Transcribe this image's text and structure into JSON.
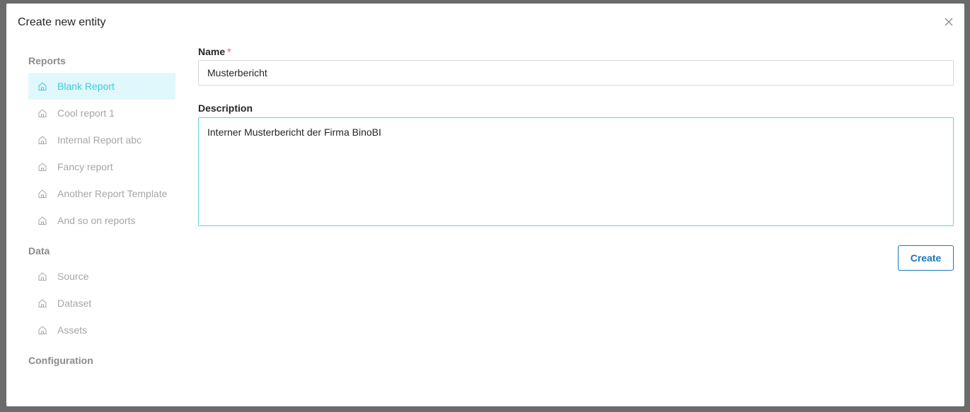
{
  "modal": {
    "title": "Create new entity",
    "close_icon": "close-icon"
  },
  "sidebar": {
    "sections": [
      {
        "title": "Reports",
        "items": [
          {
            "label": "Blank Report",
            "icon": "home-icon",
            "active": true
          },
          {
            "label": "Cool report 1",
            "icon": "home-icon"
          },
          {
            "label": "Internal Report abc",
            "icon": "home-icon"
          },
          {
            "label": "Fancy report",
            "icon": "home-icon"
          },
          {
            "label": "Another Report Template",
            "icon": "home-icon"
          },
          {
            "label": "And so on reports",
            "icon": "home-icon"
          }
        ]
      },
      {
        "title": "Data",
        "items": [
          {
            "label": "Source",
            "icon": "home-icon"
          },
          {
            "label": "Dataset",
            "icon": "home-icon"
          },
          {
            "label": "Assets",
            "icon": "home-icon"
          }
        ]
      },
      {
        "title": "Configuration",
        "items": []
      }
    ]
  },
  "form": {
    "name_label": "Name",
    "name_required_mark": "*",
    "name_value": "Musterbericht",
    "description_label": "Description",
    "description_value": "Interner Musterbericht der Firma BinoBI",
    "create_label": "Create"
  },
  "colors": {
    "accent": "#3fc9d9",
    "active_bg": "#e0f8fb",
    "button": "#1a78b4",
    "required": "#ff4d4f"
  }
}
